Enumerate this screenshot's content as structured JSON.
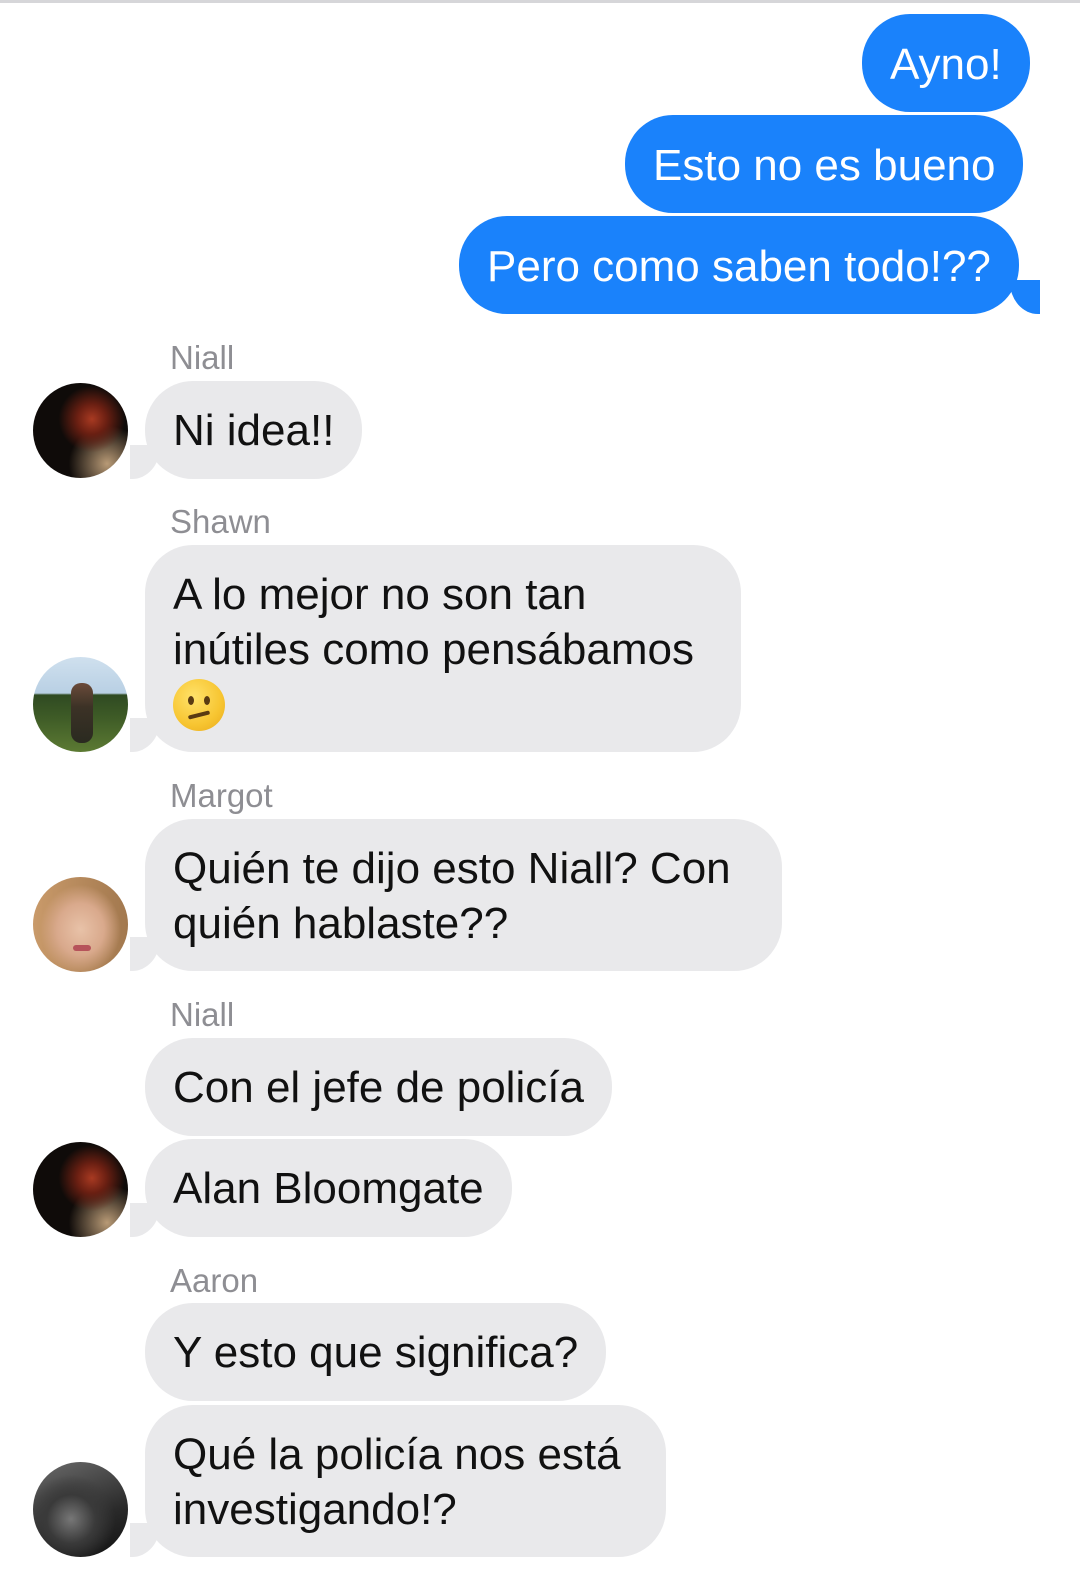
{
  "conversation": {
    "outgoing": [
      {
        "text": "Ayno!"
      },
      {
        "text": "Esto no es bueno"
      },
      {
        "text": "Pero como saben todo!??"
      }
    ],
    "groups": [
      {
        "sender": "Niall",
        "messages": [
          {
            "text": "Ni idea!!"
          }
        ]
      },
      {
        "sender": "Shawn",
        "messages": [
          {
            "line1": "A lo mejor no son tan",
            "line2": "inútiles como pensábamos",
            "emoji": "confused-face"
          }
        ]
      },
      {
        "sender": "Margot",
        "messages": [
          {
            "line1": "Quién te dijo esto Niall? Con",
            "line2": "quién hablaste??"
          }
        ]
      },
      {
        "sender": "Niall",
        "messages": [
          {
            "text": "Con el jefe de policía"
          },
          {
            "text": "Alan Bloomgate"
          }
        ]
      },
      {
        "sender": "Aaron",
        "messages": [
          {
            "text": "Y esto que significa?"
          },
          {
            "line1": "Qué la policía nos está",
            "line2": "investigando!?"
          }
        ]
      }
    ]
  },
  "colors": {
    "outgoing_bubble": "#1a82fb",
    "incoming_bubble": "#e9e9eb",
    "sender_name": "#8e8e93"
  }
}
